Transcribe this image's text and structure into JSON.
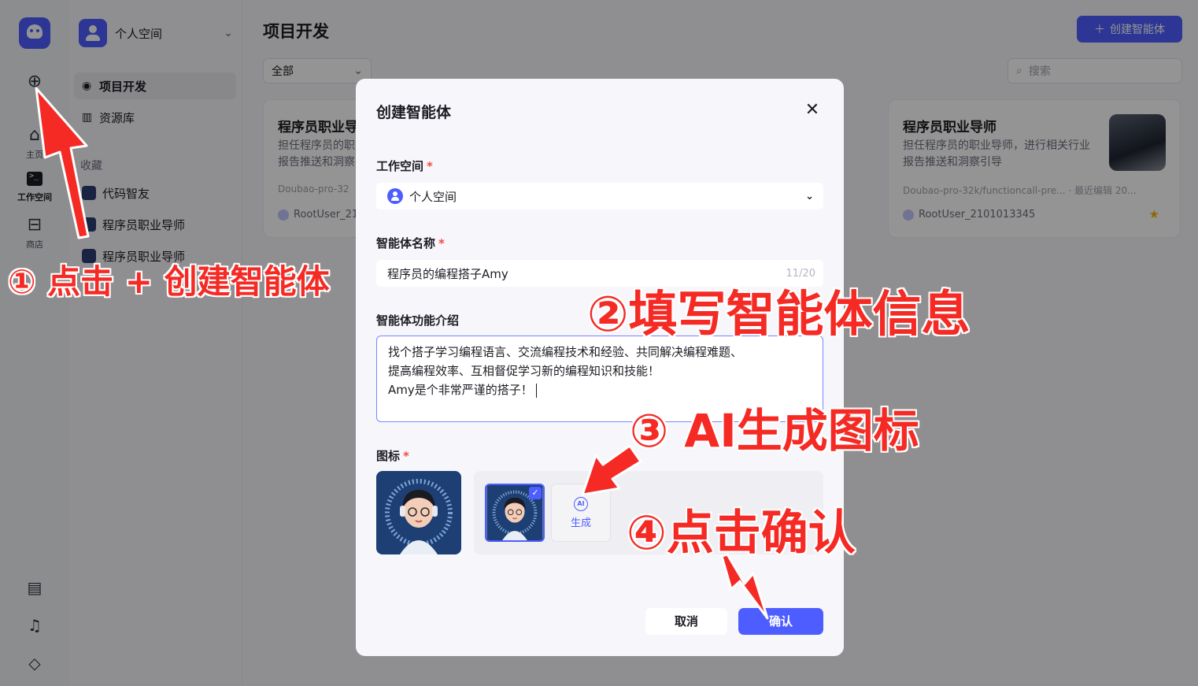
{
  "rail": {
    "items": [
      {
        "label": "主页"
      },
      {
        "label": "工作空间"
      },
      {
        "label": "商店"
      }
    ]
  },
  "sidebar": {
    "space_name": "个人空间",
    "nav": [
      {
        "label": "项目开发"
      },
      {
        "label": "资源库"
      }
    ],
    "fav_title": "收藏",
    "favorites": [
      {
        "label": "代码智友"
      },
      {
        "label": "程序员职业导师"
      },
      {
        "label": "程序员职业导师"
      }
    ]
  },
  "main": {
    "title": "项目开发",
    "create_button": "创建智能体",
    "filter_value": "全部",
    "search_placeholder": "搜索",
    "cards": [
      {
        "title": "程序员职业导",
        "desc": "担任程序员的职业导师，进行相关行业报告推送和洞察引导",
        "meta": "Doubao-pro-32",
        "user": "RootUser_21"
      },
      {
        "title": "程序员职业导师",
        "desc": "担任程序员的职业导师，进行相关行业报告推送和洞察引导",
        "meta": "Doubao-pro-32k/functioncall-pre...  · 最近编辑 20...",
        "user": "RootUser_2101013345"
      }
    ]
  },
  "modal": {
    "title": "创建智能体",
    "workspace_label": "工作空间",
    "workspace_value": "个人空间",
    "name_label": "智能体名称",
    "name_value": "程序员的编程搭子Amy",
    "name_counter": "11/20",
    "desc_label": "智能体功能介绍",
    "desc_lines": [
      "找个搭子学习编程语言、交流编程技术和经验、共同解决编程难题、",
      "提高编程效率、互相督促学习新的编程知识和技能！",
      "Amy是个非常严谨的搭子！"
    ],
    "icon_label": "图标",
    "ai_icon": "AI",
    "ai_generate": "生成",
    "cancel": "取消",
    "confirm": "确认"
  },
  "annotations": {
    "step1": "① 点击 + 创建智能体",
    "step2": "②填写智能体信息",
    "step3": "③ AI生成图标",
    "step4": "④点击确认"
  },
  "colors": {
    "accent": "#4e5dff",
    "annotation": "#f52a24",
    "required": "#f54a45"
  }
}
